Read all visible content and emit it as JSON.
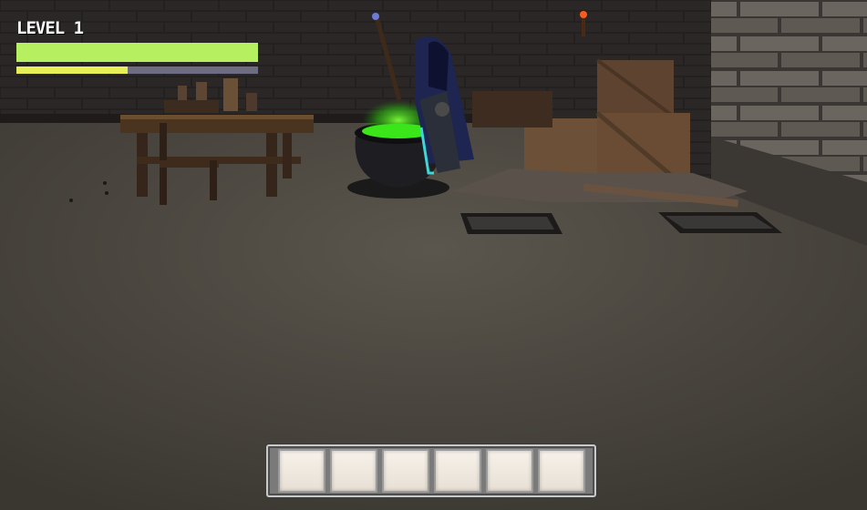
{
  "hud": {
    "level_label": "LEVEL 1",
    "health_fraction": 1.0,
    "xp_fraction": 0.46,
    "health_color": "#b6f060",
    "xp_color": "#e6ee58"
  },
  "hotbar": {
    "slot_count": 6,
    "slots": [
      "",
      "",
      "",
      "",
      "",
      ""
    ]
  },
  "scene": {
    "floor_color": "#46423b",
    "wall_color": "#262322",
    "cauldron_glow": "#4dff2a"
  }
}
